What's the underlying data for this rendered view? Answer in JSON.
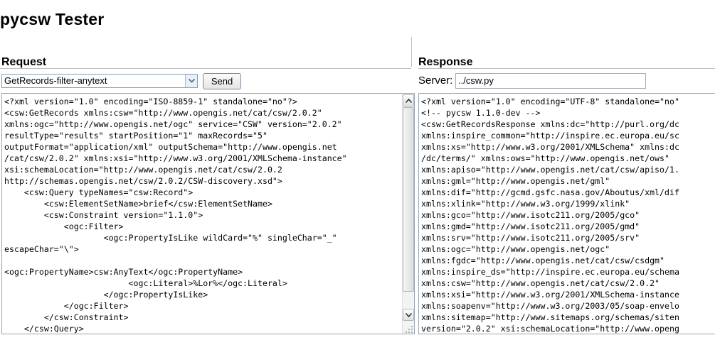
{
  "page": {
    "title": "pycsw Tester"
  },
  "request": {
    "heading": "Request",
    "selected_test": "GetRecords-filter-anytext",
    "send_label": "Send",
    "xml_lines": [
      "<?xml version=\"1.0\" encoding=\"ISO-8859-1\" standalone=\"no\"?>",
      "<csw:GetRecords xmlns:csw=\"http://www.opengis.net/cat/csw/2.0.2\"",
      "xmlns:ogc=\"http://www.opengis.net/ogc\" service=\"CSW\" version=\"2.0.2\"",
      "resultType=\"results\" startPosition=\"1\" maxRecords=\"5\"",
      "outputFormat=\"application/xml\" outputSchema=\"http://www.opengis.net",
      "/cat/csw/2.0.2\" xmlns:xsi=\"http://www.w3.org/2001/XMLSchema-instance\"",
      "xsi:schemaLocation=\"http://www.opengis.net/cat/csw/2.0.2",
      "http://schemas.opengis.net/csw/2.0.2/CSW-discovery.xsd\">",
      "    <csw:Query typeNames=\"csw:Record\">",
      "        <csw:ElementSetName>brief</csw:ElementSetName>",
      "        <csw:Constraint version=\"1.1.0\">",
      "            <ogc:Filter>",
      "                    <ogc:PropertyIsLike wildCard=\"%\" singleChar=\"_\"",
      "escapeChar=\"\\\">",
      "",
      "<ogc:PropertyName>csw:AnyText</ogc:PropertyName>",
      "                         <ogc:Literal>%Lor%</ogc:Literal>",
      "                    </ogc:PropertyIsLike>",
      "            </ogc:Filter>",
      "        </csw:Constraint>",
      "    </csw:Query>"
    ]
  },
  "response": {
    "heading": "Response",
    "server_label": "Server:",
    "server_value": "../csw.py",
    "xml_lines": [
      "<?xml version=\"1.0\" encoding=\"UTF-8\" standalone=\"no\"",
      "<!-- pycsw 1.1.0-dev -->",
      "<csw:GetRecordsResponse xmlns:dc=\"http://purl.org/dc",
      "xmlns:inspire_common=\"http://inspire.ec.europa.eu/sc",
      "xmlns:xs=\"http://www.w3.org/2001/XMLSchema\" xmlns:dc",
      "/dc/terms/\" xmlns:ows=\"http://www.opengis.net/ows\"",
      "xmlns:apiso=\"http://www.opengis.net/cat/csw/apiso/1.",
      "xmlns:gml=\"http://www.opengis.net/gml\"",
      "xmlns:dif=\"http://gcmd.gsfc.nasa.gov/Aboutus/xml/dif",
      "xmlns:xlink=\"http://www.w3.org/1999/xlink\"",
      "xmlns:gco=\"http://www.isotc211.org/2005/gco\"",
      "xmlns:gmd=\"http://www.isotc211.org/2005/gmd\"",
      "xmlns:srv=\"http://www.isotc211.org/2005/srv\"",
      "xmlns:ogc=\"http://www.opengis.net/ogc\"",
      "xmlns:fgdc=\"http://www.opengis.net/cat/csw/csdgm\"",
      "xmlns:inspire_ds=\"http://inspire.ec.europa.eu/schema",
      "xmlns:csw=\"http://www.opengis.net/cat/csw/2.0.2\"",
      "xmlns:xsi=\"http://www.w3.org/2001/XMLSchema-instance",
      "xmlns:soapenv=\"http://www.w3.org/2003/05/soap-envelo",
      "xmlns:sitemap=\"http://www.sitemaps.org/schemas/siten",
      "version=\"2.0.2\" xsi:schemaLocation=\"http://www.openg"
    ]
  },
  "icons": {
    "dropdown": "chevron-down-icon",
    "scroll_up": "arrow-up-icon",
    "scroll_down": "arrow-down-icon",
    "resize": "resize-grip-icon"
  },
  "colors": {
    "field_border": "#7f9db9",
    "separator": "#c0c0c0"
  }
}
